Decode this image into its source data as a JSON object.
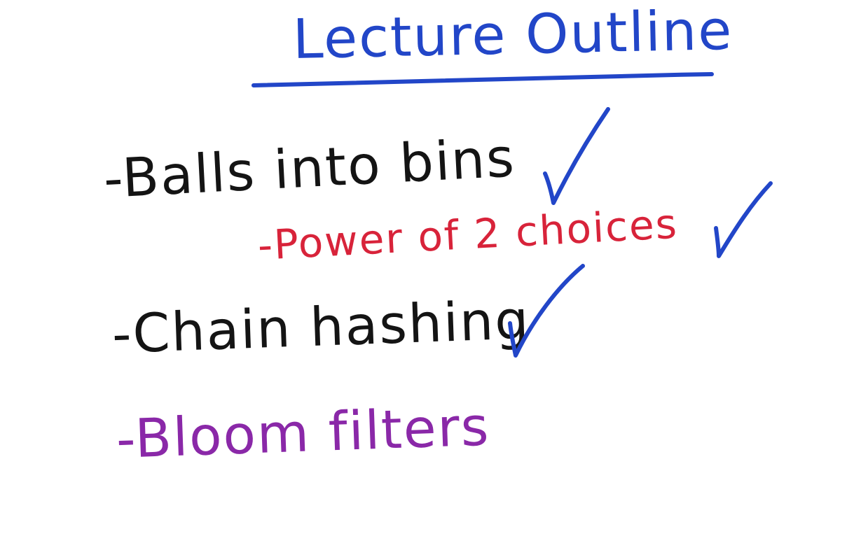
{
  "board": {
    "title": "Lecture Outline",
    "items": [
      {
        "text": "-Balls into bins",
        "checked": true
      },
      {
        "text": "-Power of 2 choices",
        "checked": true,
        "indent": true
      },
      {
        "text": "-Chain hashing",
        "checked": true
      },
      {
        "text": "-Bloom filters",
        "checked": false
      }
    ]
  },
  "colors": {
    "title": "#2246c8",
    "check": "#2246c8",
    "black_ink": "#141414",
    "red_ink": "#d8233a",
    "purple_ink": "#8a28a8"
  },
  "icons": {
    "check": "checkmark-icon",
    "underline": "underline-stroke"
  }
}
